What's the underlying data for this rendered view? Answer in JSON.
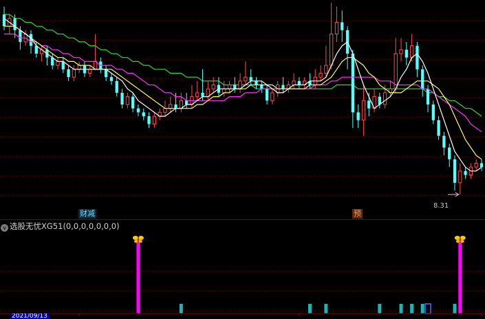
{
  "indicator": {
    "collapse_icon": "chevron-down-icon",
    "name": "选股无忧XG51",
    "params": "(0,0,0,0,0,0,0)"
  },
  "tags": {
    "cj": "财减",
    "yu": "预"
  },
  "price_note": "8.31",
  "date_label": "2021/09/13",
  "colors": {
    "up": "#ff4c4c",
    "down": "#54ffff",
    "ma5": "#ffffff",
    "ma10": "#ffff55",
    "ma20": "#ff33ff",
    "ma60": "#33dd33",
    "grid": "#8b0000",
    "signal": "#ff00ff",
    "marker": "#1fb3b3"
  },
  "chart_data": {
    "type": "candlestick",
    "title": "",
    "ylim": [
      8.0,
      13.2
    ],
    "series_lines": [
      "MA5",
      "MA10",
      "MA20",
      "MA60"
    ],
    "candles": [
      [
        12.9,
        12.6,
        13.1,
        12.5
      ],
      [
        12.6,
        12.8,
        12.9,
        12.4
      ],
      [
        12.8,
        12.5,
        12.9,
        12.3
      ],
      [
        12.5,
        12.2,
        12.6,
        12.0
      ],
      [
        12.2,
        12.4,
        12.5,
        12.1
      ],
      [
        12.4,
        12.1,
        12.5,
        11.9
      ],
      [
        12.1,
        11.9,
        12.2,
        11.8
      ],
      [
        11.9,
        12.0,
        12.1,
        11.7
      ],
      [
        12.0,
        11.8,
        12.1,
        11.6
      ],
      [
        11.8,
        11.6,
        11.9,
        11.5
      ],
      [
        11.6,
        11.7,
        11.8,
        11.5
      ],
      [
        11.7,
        11.5,
        11.8,
        11.4
      ],
      [
        11.5,
        11.3,
        11.6,
        11.2
      ],
      [
        11.3,
        11.5,
        11.6,
        11.2
      ],
      [
        11.5,
        11.6,
        11.7,
        11.4
      ],
      [
        11.6,
        11.4,
        11.7,
        11.3
      ],
      [
        11.4,
        11.5,
        11.6,
        11.3
      ],
      [
        11.5,
        11.7,
        12.4,
        11.5
      ],
      [
        11.7,
        11.5,
        11.8,
        11.4
      ],
      [
        11.5,
        11.3,
        11.6,
        11.2
      ],
      [
        11.3,
        11.2,
        11.4,
        11.1
      ],
      [
        11.2,
        10.9,
        11.3,
        10.8
      ],
      [
        10.9,
        10.6,
        11.0,
        10.5
      ],
      [
        10.6,
        10.8,
        10.9,
        10.5
      ],
      [
        10.8,
        10.5,
        10.9,
        10.4
      ],
      [
        10.5,
        10.4,
        10.6,
        10.3
      ],
      [
        10.4,
        10.3,
        10.5,
        10.2
      ],
      [
        10.3,
        10.1,
        10.4,
        10.0
      ],
      [
        10.1,
        10.3,
        10.4,
        10.0
      ],
      [
        10.3,
        10.4,
        10.5,
        10.2
      ],
      [
        10.4,
        10.5,
        10.7,
        10.3
      ],
      [
        10.5,
        10.6,
        10.8,
        10.4
      ],
      [
        10.6,
        10.5,
        10.9,
        10.4
      ],
      [
        10.5,
        10.7,
        10.9,
        10.4
      ],
      [
        10.7,
        10.6,
        10.9,
        10.5
      ],
      [
        10.6,
        10.8,
        11.1,
        10.5
      ],
      [
        10.8,
        10.9,
        11.2,
        10.7
      ],
      [
        10.9,
        10.8,
        11.5,
        10.7
      ],
      [
        10.8,
        11.0,
        11.2,
        10.7
      ],
      [
        11.0,
        11.1,
        11.3,
        10.9
      ],
      [
        11.1,
        10.9,
        11.3,
        10.8
      ],
      [
        10.9,
        11.0,
        11.2,
        10.8
      ],
      [
        11.0,
        11.1,
        11.2,
        10.9
      ],
      [
        11.1,
        11.0,
        11.3,
        10.9
      ],
      [
        11.0,
        11.2,
        11.4,
        10.9
      ],
      [
        11.2,
        11.3,
        11.7,
        11.1
      ],
      [
        11.3,
        11.2,
        11.5,
        11.1
      ],
      [
        11.2,
        11.1,
        11.3,
        11.0
      ],
      [
        11.1,
        11.0,
        11.2,
        10.9
      ],
      [
        11.0,
        10.7,
        11.1,
        10.6
      ],
      [
        10.7,
        10.9,
        11.0,
        10.6
      ],
      [
        10.9,
        11.1,
        11.2,
        10.8
      ],
      [
        11.1,
        11.0,
        11.3,
        10.9
      ],
      [
        11.0,
        11.1,
        11.2,
        10.9
      ],
      [
        11.1,
        11.2,
        11.4,
        11.0
      ],
      [
        11.2,
        11.1,
        11.3,
        11.0
      ],
      [
        11.1,
        11.2,
        11.3,
        11.0
      ],
      [
        11.2,
        11.1,
        11.4,
        11.0
      ],
      [
        11.1,
        11.3,
        11.5,
        11.0
      ],
      [
        11.3,
        11.4,
        11.6,
        11.2
      ],
      [
        11.4,
        11.6,
        12.1,
        11.3
      ],
      [
        11.6,
        12.4,
        13.2,
        11.5
      ],
      [
        12.4,
        12.7,
        13.1,
        12.2
      ],
      [
        12.7,
        12.5,
        13.0,
        12.2
      ],
      [
        12.5,
        11.9,
        12.6,
        11.5
      ],
      [
        11.9,
        10.4,
        12.0,
        10.0
      ],
      [
        10.4,
        10.2,
        10.6,
        10.0
      ],
      [
        10.2,
        10.7,
        11.1,
        9.8
      ],
      [
        10.7,
        10.5,
        10.9,
        10.3
      ],
      [
        10.5,
        10.8,
        11.0,
        10.4
      ],
      [
        10.8,
        10.6,
        10.9,
        10.5
      ],
      [
        10.6,
        10.9,
        11.1,
        10.5
      ],
      [
        10.9,
        11.0,
        11.2,
        10.8
      ],
      [
        11.0,
        11.9,
        12.3,
        10.9
      ],
      [
        11.9,
        12.0,
        12.3,
        11.7
      ],
      [
        12.0,
        11.8,
        12.2,
        11.6
      ],
      [
        11.8,
        12.1,
        12.4,
        11.7
      ],
      [
        12.1,
        11.5,
        12.2,
        11.3
      ],
      [
        11.5,
        11.0,
        11.6,
        10.8
      ],
      [
        11.0,
        10.6,
        11.1,
        10.4
      ],
      [
        10.6,
        10.2,
        10.7,
        10.1
      ],
      [
        10.2,
        9.8,
        10.3,
        9.7
      ],
      [
        9.8,
        9.5,
        9.9,
        9.3
      ],
      [
        9.5,
        9.2,
        9.6,
        9.0
      ],
      [
        9.2,
        8.6,
        9.3,
        8.4
      ],
      [
        8.6,
        8.9,
        9.1,
        8.3
      ],
      [
        8.9,
        8.8,
        9.0,
        8.7
      ],
      [
        8.8,
        9.0,
        9.1,
        8.7
      ],
      [
        9.0,
        9.1,
        9.2,
        8.9
      ],
      [
        9.1,
        9.0,
        9.2,
        8.9
      ]
    ],
    "ma5": [
      12.8,
      12.7,
      12.6,
      12.5,
      12.4,
      12.3,
      12.1,
      12.0,
      11.9,
      11.8,
      11.7,
      11.7,
      11.6,
      11.5,
      11.5,
      11.5,
      11.5,
      11.5,
      11.5,
      11.5,
      11.4,
      11.3,
      11.2,
      11.0,
      10.9,
      10.7,
      10.6,
      10.5,
      10.4,
      10.3,
      10.3,
      10.4,
      10.5,
      10.5,
      10.6,
      10.6,
      10.7,
      10.8,
      10.8,
      10.9,
      11.0,
      11.0,
      11.0,
      11.0,
      11.0,
      11.1,
      11.2,
      11.2,
      11.2,
      11.1,
      11.0,
      10.9,
      10.9,
      11.0,
      11.1,
      11.1,
      11.1,
      11.2,
      11.2,
      11.2,
      11.3,
      11.6,
      11.9,
      12.1,
      12.2,
      11.9,
      11.5,
      11.1,
      10.8,
      10.5,
      10.6,
      10.7,
      10.8,
      11.0,
      11.3,
      11.5,
      11.8,
      11.9,
      11.7,
      11.4,
      11.0,
      10.6,
      10.2,
      9.8,
      9.4,
      9.2,
      9.0,
      8.9,
      8.9,
      9.0
    ],
    "ma10": [
      12.6,
      12.6,
      12.6,
      12.5,
      12.4,
      12.3,
      12.2,
      12.1,
      12.0,
      11.9,
      11.8,
      11.8,
      11.7,
      11.7,
      11.6,
      11.6,
      11.6,
      11.5,
      11.5,
      11.5,
      11.5,
      11.4,
      11.3,
      11.2,
      11.1,
      11.0,
      10.9,
      10.8,
      10.7,
      10.6,
      10.5,
      10.5,
      10.5,
      10.5,
      10.5,
      10.5,
      10.6,
      10.6,
      10.7,
      10.8,
      10.8,
      10.9,
      10.9,
      11.0,
      11.0,
      11.0,
      11.1,
      11.1,
      11.1,
      11.1,
      11.1,
      11.0,
      11.0,
      11.0,
      11.0,
      11.0,
      11.0,
      11.1,
      11.1,
      11.1,
      11.2,
      11.3,
      11.5,
      11.7,
      11.8,
      11.8,
      11.7,
      11.6,
      11.4,
      11.3,
      11.1,
      11.0,
      10.9,
      10.9,
      10.9,
      11.0,
      11.1,
      11.2,
      11.2,
      11.2,
      11.1,
      11.0,
      10.8,
      10.6,
      10.3,
      10.0,
      9.7,
      9.5,
      9.3,
      9.2
    ],
    "ma20": [
      12.4,
      12.4,
      12.4,
      12.3,
      12.3,
      12.2,
      12.2,
      12.1,
      12.1,
      12.0,
      12.0,
      11.9,
      11.9,
      11.8,
      11.8,
      11.7,
      11.7,
      11.7,
      11.6,
      11.6,
      11.6,
      11.5,
      11.5,
      11.4,
      11.4,
      11.3,
      11.2,
      11.1,
      11.1,
      11.0,
      10.9,
      10.9,
      10.8,
      10.8,
      10.7,
      10.7,
      10.7,
      10.7,
      10.7,
      10.7,
      10.7,
      10.7,
      10.8,
      10.8,
      10.8,
      10.9,
      10.9,
      10.9,
      11.0,
      11.0,
      11.0,
      11.0,
      11.0,
      11.0,
      11.0,
      11.0,
      11.0,
      11.0,
      11.1,
      11.1,
      11.1,
      11.2,
      11.2,
      11.3,
      11.3,
      11.3,
      11.3,
      11.3,
      11.3,
      11.3,
      11.2,
      11.2,
      11.2,
      11.1,
      11.1,
      11.1,
      11.1,
      11.1,
      11.0,
      11.0,
      10.9,
      10.8,
      10.7,
      10.6,
      10.5,
      10.4,
      10.3,
      10.1,
      10.0,
      9.9
    ],
    "ma60": [
      12.9,
      12.9,
      12.8,
      12.8,
      12.7,
      12.7,
      12.6,
      12.6,
      12.5,
      12.5,
      12.4,
      12.4,
      12.3,
      12.3,
      12.2,
      12.2,
      12.1,
      12.1,
      12.0,
      12.0,
      11.9,
      11.9,
      11.8,
      11.8,
      11.7,
      11.7,
      11.6,
      11.6,
      11.5,
      11.5,
      11.5,
      11.4,
      11.4,
      11.4,
      11.3,
      11.3,
      11.3,
      11.2,
      11.2,
      11.2,
      11.2,
      11.1,
      11.1,
      11.1,
      11.1,
      11.1,
      11.1,
      11.0,
      11.0,
      11.0,
      11.0,
      11.0,
      11.0,
      11.0,
      11.0,
      11.0,
      11.0,
      11.0,
      11.0,
      11.0,
      11.0,
      11.0,
      11.1,
      11.1,
      11.1,
      11.1,
      11.0,
      11.0,
      11.0,
      11.0,
      11.0,
      11.0,
      11.0,
      11.0,
      11.0,
      11.0,
      11.0,
      11.0,
      11.0,
      10.9,
      10.9,
      10.8,
      10.8,
      10.7,
      10.7,
      10.6,
      10.5,
      10.5,
      10.4,
      10.3
    ],
    "signal_bars": [
      25,
      85
    ],
    "blocks": [
      33,
      57,
      60,
      70,
      74,
      76,
      78,
      84
    ],
    "blocks_blue": [
      79
    ]
  }
}
